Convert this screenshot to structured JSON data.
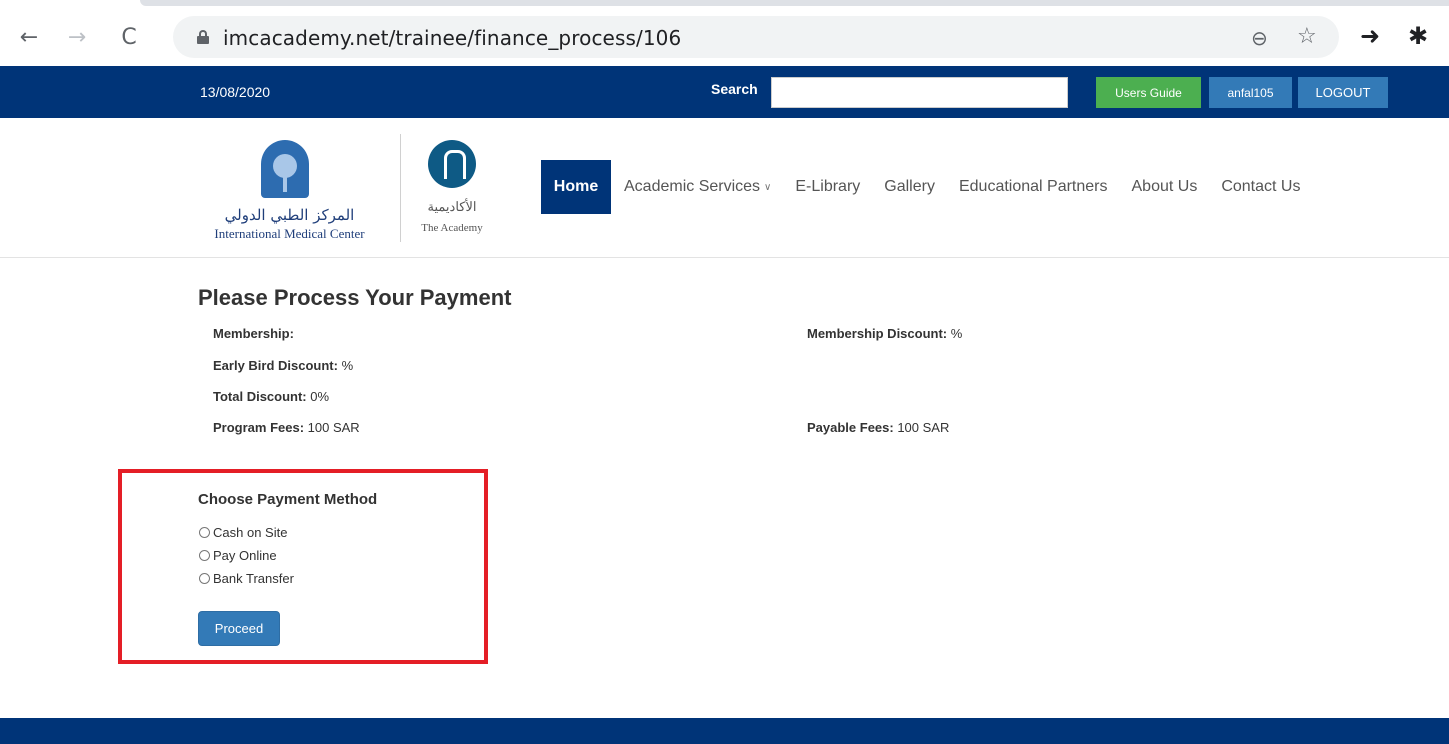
{
  "browser": {
    "back_glyph": "←",
    "forward_glyph": "→",
    "reload_glyph": "C",
    "url": "imcacademy.net/trainee/finance_process/106",
    "icons": [
      "back-arrow-icon",
      "forward-arrow-icon",
      "reload-icon",
      "lock-icon",
      "zoom-icon",
      "star-icon",
      "share-icon",
      "extensions-icon"
    ]
  },
  "topbar": {
    "date": "13/08/2020",
    "search_label": "Search",
    "search_value": "",
    "users_guide": "Users Guide",
    "username": "anfal105",
    "logout": "LOGOUT",
    "colors": {
      "bar": "#003478",
      "guide": "#4caf50",
      "user": "#337ab7"
    }
  },
  "logos": {
    "imc_arabic": "المركز الطبي الدولي",
    "imc_english": "International Medical Center",
    "academy_arabic": "الأكاديمية",
    "academy_english": "The Academy"
  },
  "nav": {
    "home": "Home",
    "academic_services": "Academic Services",
    "elibrary": "E-Library",
    "gallery": "Gallery",
    "educational_partners": "Educational Partners",
    "about_us": "About Us",
    "contact_us": "Contact Us"
  },
  "content": {
    "title": "Please Process Your Payment",
    "membership_label": "Membership:",
    "membership_value": "",
    "membership_discount_label": "Membership Discount:",
    "membership_discount_value": " %",
    "early_bird_label": "Early Bird Discount:",
    "early_bird_value": " %",
    "total_discount_label": "Total Discount:",
    "total_discount_value": " 0%",
    "program_fees_label": "Program Fees:",
    "program_fees_value": " 100 SAR",
    "payable_fees_label": "Payable Fees:",
    "payable_fees_value": " 100 SAR"
  },
  "payment": {
    "title": "Choose Payment Method",
    "options": [
      "Cash on Site",
      "Pay Online",
      "Bank Transfer"
    ],
    "proceed": "Proceed",
    "highlight_color": "#e41e26"
  }
}
